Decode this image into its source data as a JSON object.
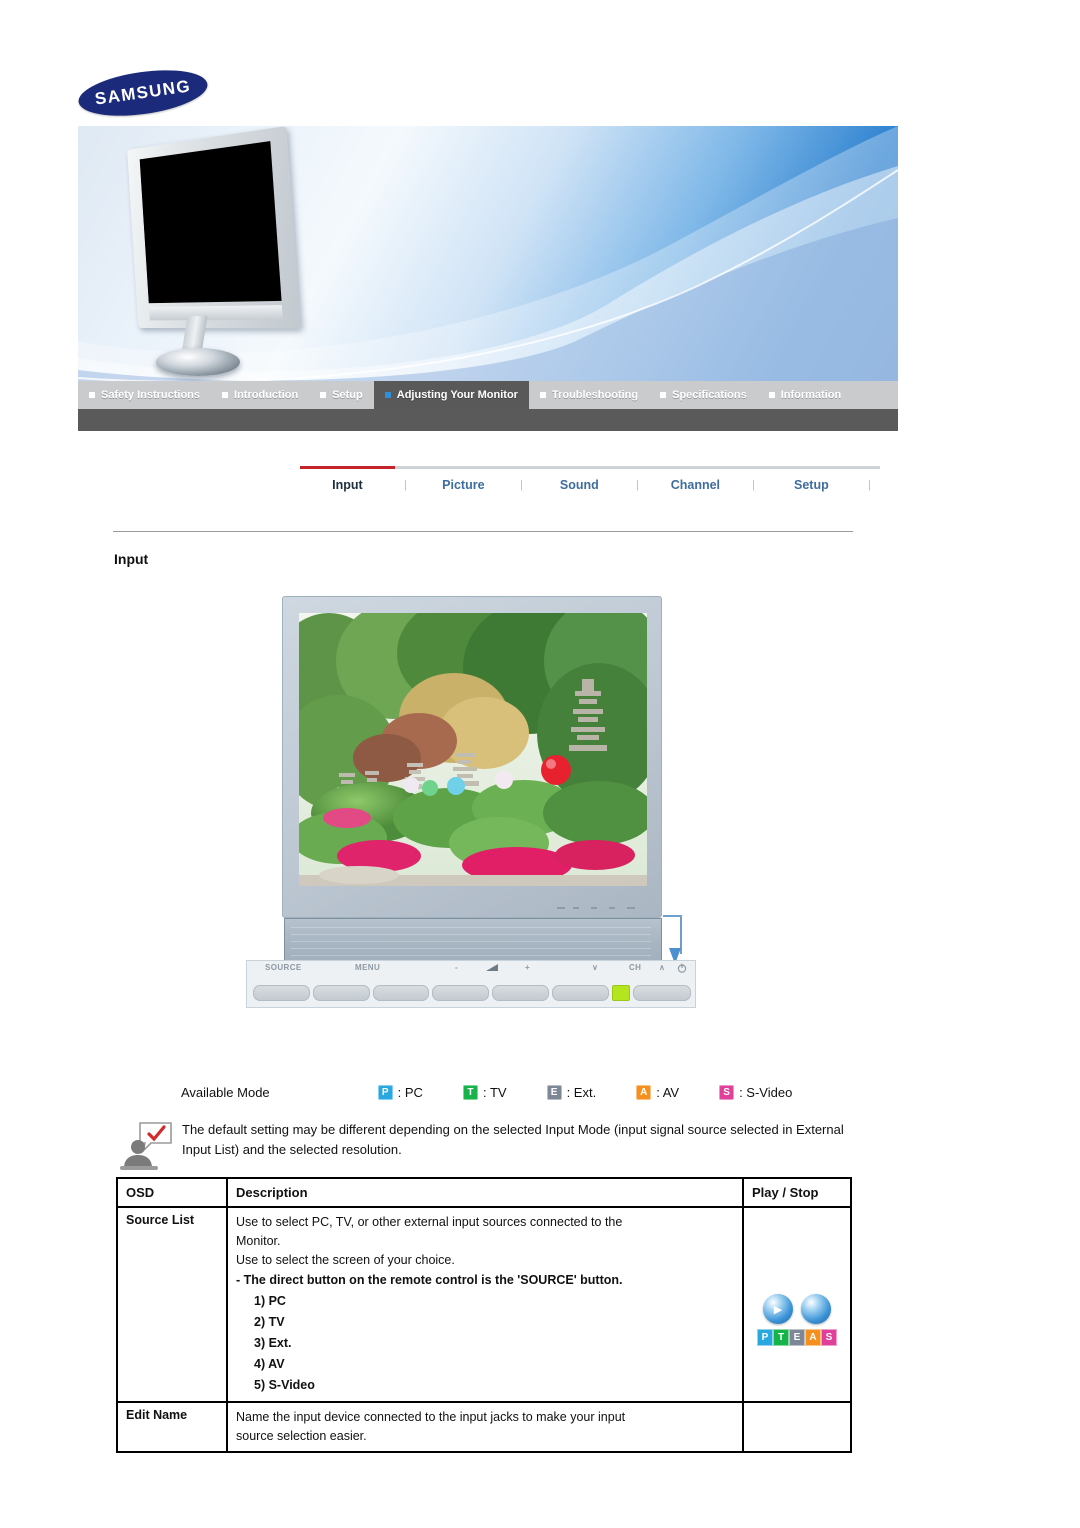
{
  "brand": {
    "logo_text": "SAMSUNG"
  },
  "topnav": {
    "items": [
      {
        "label": "Safety Instructions",
        "active": false
      },
      {
        "label": "Introduction",
        "active": false
      },
      {
        "label": "Setup",
        "active": false
      },
      {
        "label": "Adjusting Your Monitor",
        "active": true
      },
      {
        "label": "Troubleshooting",
        "active": false
      },
      {
        "label": "Specifications",
        "active": false
      },
      {
        "label": "Information",
        "active": false
      }
    ]
  },
  "subnav": {
    "separator": "|",
    "tabs": [
      {
        "label": "Input",
        "active": true
      },
      {
        "label": "Picture",
        "active": false
      },
      {
        "label": "Sound",
        "active": false
      },
      {
        "label": "Channel",
        "active": false
      },
      {
        "label": "Setup",
        "active": false
      }
    ]
  },
  "section": {
    "title": "Input"
  },
  "monitor_figure": {
    "button_labels": [
      "SOURCE",
      "MENU",
      "-",
      "volume-icon",
      "+",
      "∨",
      "CH",
      "∧",
      "power-icon"
    ]
  },
  "available_mode": {
    "label": "Available Mode",
    "modes": [
      {
        "badge": "P",
        "text": ": PC",
        "color": "#29a8df"
      },
      {
        "badge": "T",
        "text": ": TV",
        "color": "#16b34a"
      },
      {
        "badge": "E",
        "text": ": Ext.",
        "color": "#7d8796"
      },
      {
        "badge": "A",
        "text": ": AV",
        "color": "#f5901e"
      },
      {
        "badge": "S",
        "text": ": S-Video",
        "color": "#e0409a"
      }
    ]
  },
  "note": {
    "icon": "note-person-icon",
    "text": "The default setting may be different depending on the selected Input Mode (input signal source selected in External Input List) and the selected resolution."
  },
  "table": {
    "headers": [
      "OSD",
      "Description",
      "Play / Stop"
    ],
    "rows": [
      {
        "osd": "Source List",
        "description_lines": [
          {
            "text": "Use to select PC, TV, or other external input sources connected to the",
            "style": "normal"
          },
          {
            "text": "Monitor.",
            "style": "normal"
          },
          {
            "text": "Use to select the screen of your choice.",
            "style": "normal"
          },
          {
            "text": "- The direct button on the remote control is the 'SOURCE' button.",
            "style": "bold"
          },
          {
            "text": "1) PC",
            "style": "num"
          },
          {
            "text": "2) TV",
            "style": "num"
          },
          {
            "text": "3) Ext.",
            "style": "num"
          },
          {
            "text": "4) AV",
            "style": "num"
          },
          {
            "text": "5) S-Video",
            "style": "num"
          }
        ],
        "has_play_icons": true
      },
      {
        "osd": "Edit Name",
        "description_lines": [
          {
            "text": "Name the input device connected to the input jacks to make your input",
            "style": "normal"
          },
          {
            "text": "source selection easier.",
            "style": "normal"
          }
        ],
        "has_play_icons": false
      }
    ],
    "play_icons": {
      "play_glyph": "▶",
      "stop_glyph": "",
      "pteas": [
        {
          "letter": "P",
          "color": "#29a8df"
        },
        {
          "letter": "T",
          "color": "#16b34a"
        },
        {
          "letter": "E",
          "color": "#7d8796"
        },
        {
          "letter": "A",
          "color": "#f5901e"
        },
        {
          "letter": "S",
          "color": "#e0409a"
        }
      ]
    }
  }
}
